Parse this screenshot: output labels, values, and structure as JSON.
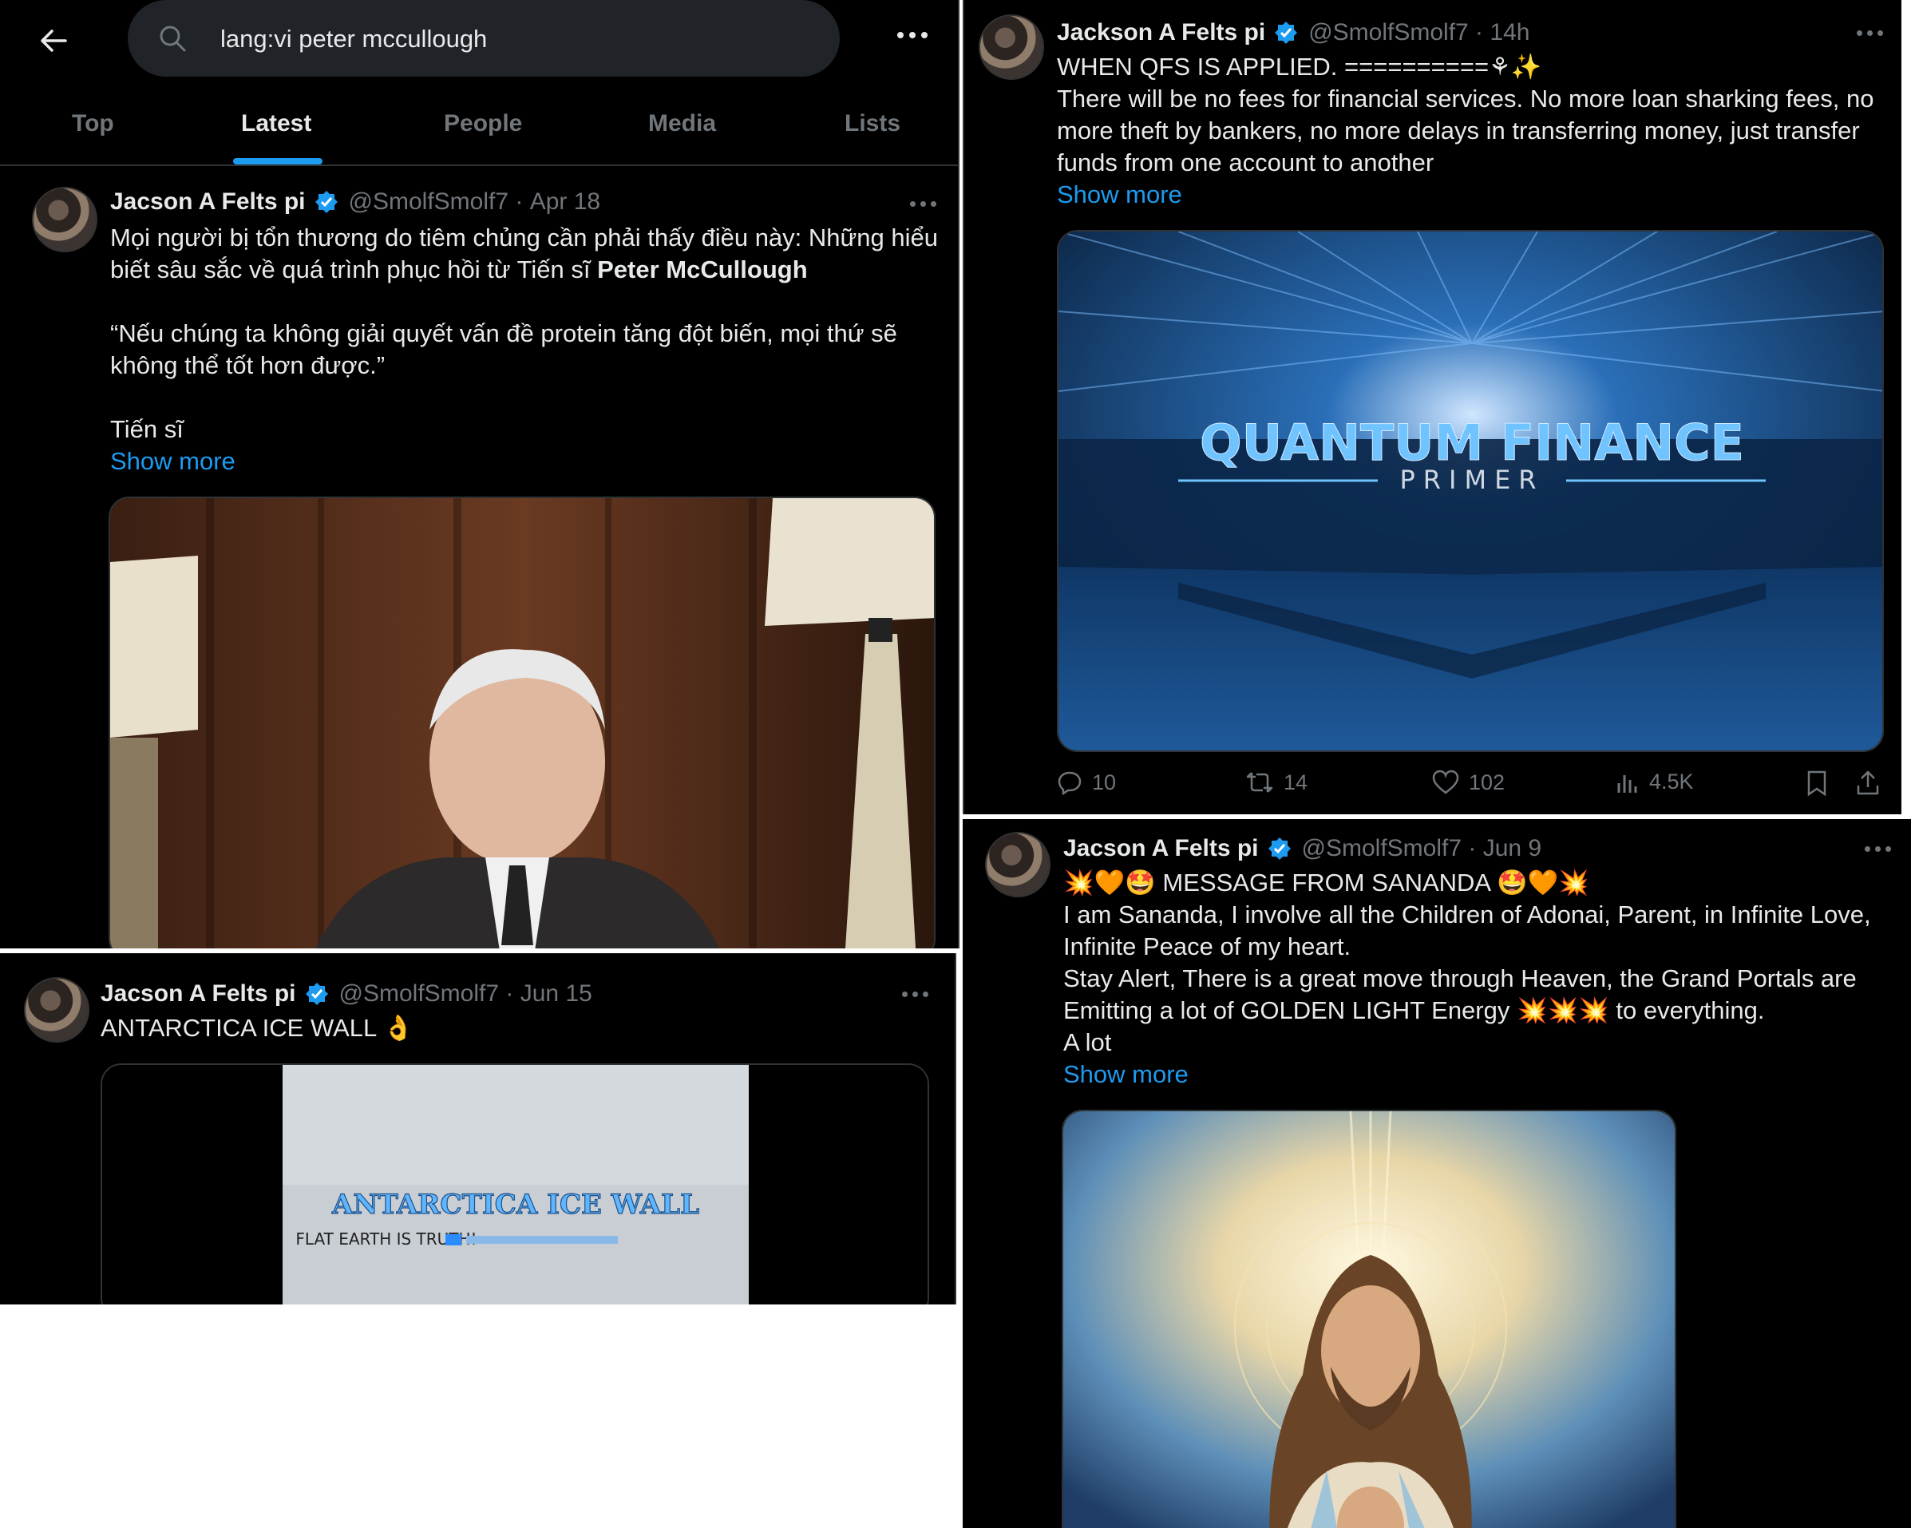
{
  "search": {
    "query": "lang:vi peter mccullough"
  },
  "tabs": [
    {
      "label": "Top"
    },
    {
      "label": "Latest"
    },
    {
      "label": "People"
    },
    {
      "label": "Media"
    },
    {
      "label": "Lists"
    }
  ],
  "active_tab": "Latest",
  "tweet1": {
    "name": "Jacson A Felts pi",
    "handle": "@SmolfSmolf7",
    "date": "Apr 18",
    "line1": "Mọi người bị tổn thương do tiêm chủng cần phải thấy điều này: Những hiểu",
    "line2a": "biết sâu sắc về quá trình phục hồi từ Tiến sĩ ",
    "line2b": "Peter McCullough",
    "line3": "“Nếu chúng ta không giải quyết vấn đề protein tăng đột biến, mọi thứ sẽ",
    "line4": "không thể tốt hơn được.”",
    "line5": "Tiến sĩ",
    "show_more": "Show more"
  },
  "tweet2": {
    "name": "Jackson A Felts pi",
    "handle": "@SmolfSmolf7",
    "date": "14h",
    "line1": "WHEN QFS IS APPLIED. ==========⚘✨",
    "line2": "There will be no fees for financial services. No more loan sharking fees, no",
    "line3": "more theft by bankers, no more delays in transferring money, just transfer",
    "line4": "funds from one account to another",
    "show_more": "Show more",
    "image_title": "QUANTUM FINANCE",
    "image_subtitle": "PRIMER",
    "replies": "10",
    "reposts": "14",
    "likes": "102",
    "views": "4.5K"
  },
  "tweet3": {
    "name": "Jacson A Felts pi",
    "handle": "@SmolfSmolf7",
    "date": "Jun 15",
    "text": "ANTARCTICA ICE WALL 👌",
    "image_title": "ANTARCTICA ICE WALL",
    "image_subtitle": "FLAT EARTH IS TRUTH!"
  },
  "tweet4": {
    "name": "Jacson A Felts pi",
    "handle": "@SmolfSmolf7",
    "date": "Jun 9",
    "line1": "💥🧡🤩 MESSAGE FROM SANANDA 🤩🧡💥",
    "line2": "I am Sananda, I involve all the Children of Adonai, Parent, in Infinite Love,",
    "line3": "Infinite Peace of my heart.",
    "line4": "Stay Alert, There is a great move through Heaven, the Grand Portals are",
    "line5": "Emitting a lot of GOLDEN LIGHT Energy 💥💥💥 to everything.",
    "line6": "A lot",
    "show_more": "Show more"
  },
  "colors": {
    "accent": "#1d9bf0",
    "background": "#000000",
    "muted": "#71767b",
    "text": "#e7e9ea"
  }
}
